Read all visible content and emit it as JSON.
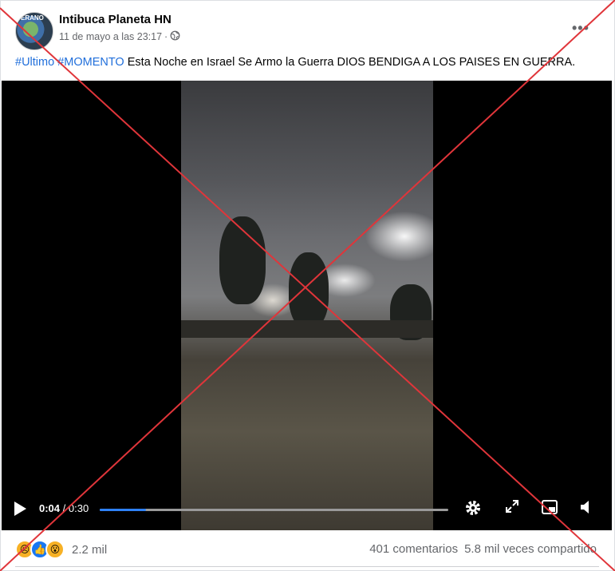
{
  "post": {
    "page_name": "Intibuca Planeta HN",
    "avatar_text": "ERANO",
    "timestamp": "11 de mayo a las 23:17",
    "separator": "·",
    "privacy_icon": "globe-icon",
    "more_icon": "more-options-icon",
    "more_glyph": "•••",
    "caption": {
      "hashtag1": "#Ultimo",
      "hashtag2": "#MOMENTO",
      "text": " Esta Noche en Israel Se Armo la Guerra DIOS BENDIGA A LOS PAISES EN GUERRA."
    }
  },
  "video": {
    "current_time": "0:04",
    "total_time": " / 0:30",
    "progress": 0.133,
    "controls": [
      "play-icon",
      "settings-icon",
      "fullscreen-icon",
      "miniplayer-icon",
      "volume-icon"
    ]
  },
  "engagement": {
    "reaction_count": "2.2 mil",
    "reactions": [
      "sad",
      "like",
      "wow"
    ],
    "comments": "401 comentarios",
    "shares": "5.8 mil veces compartido"
  },
  "colors": {
    "hashtag": "#216fdb",
    "progress": "#2e81f7",
    "overlay_x": "#e0353a"
  }
}
